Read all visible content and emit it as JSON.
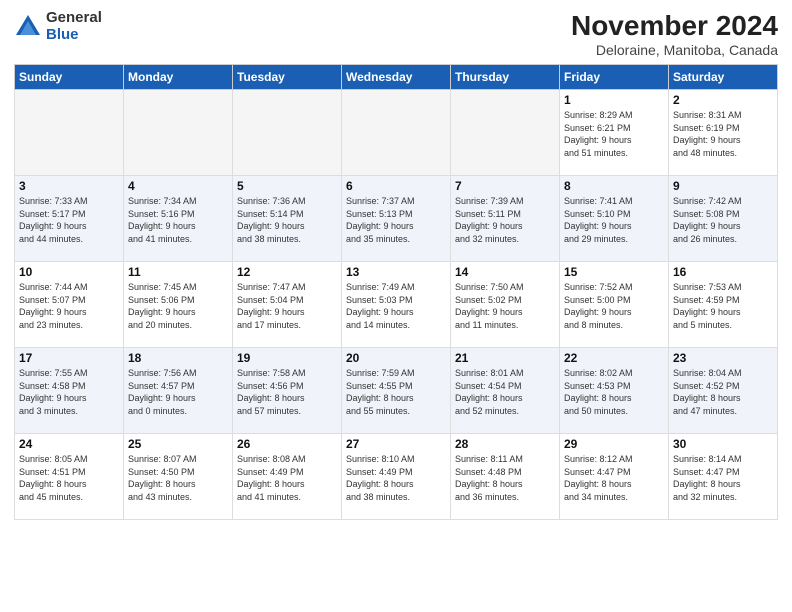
{
  "header": {
    "logo_general": "General",
    "logo_blue": "Blue",
    "month_year": "November 2024",
    "location": "Deloraine, Manitoba, Canada"
  },
  "days_of_week": [
    "Sunday",
    "Monday",
    "Tuesday",
    "Wednesday",
    "Thursday",
    "Friday",
    "Saturday"
  ],
  "weeks": [
    [
      {
        "day": "",
        "detail": "",
        "empty": true
      },
      {
        "day": "",
        "detail": "",
        "empty": true
      },
      {
        "day": "",
        "detail": "",
        "empty": true
      },
      {
        "day": "",
        "detail": "",
        "empty": true
      },
      {
        "day": "",
        "detail": "",
        "empty": true
      },
      {
        "day": "1",
        "detail": "Sunrise: 8:29 AM\nSunset: 6:21 PM\nDaylight: 9 hours\nand 51 minutes."
      },
      {
        "day": "2",
        "detail": "Sunrise: 8:31 AM\nSunset: 6:19 PM\nDaylight: 9 hours\nand 48 minutes."
      }
    ],
    [
      {
        "day": "3",
        "detail": "Sunrise: 7:33 AM\nSunset: 5:17 PM\nDaylight: 9 hours\nand 44 minutes."
      },
      {
        "day": "4",
        "detail": "Sunrise: 7:34 AM\nSunset: 5:16 PM\nDaylight: 9 hours\nand 41 minutes."
      },
      {
        "day": "5",
        "detail": "Sunrise: 7:36 AM\nSunset: 5:14 PM\nDaylight: 9 hours\nand 38 minutes."
      },
      {
        "day": "6",
        "detail": "Sunrise: 7:37 AM\nSunset: 5:13 PM\nDaylight: 9 hours\nand 35 minutes."
      },
      {
        "day": "7",
        "detail": "Sunrise: 7:39 AM\nSunset: 5:11 PM\nDaylight: 9 hours\nand 32 minutes."
      },
      {
        "day": "8",
        "detail": "Sunrise: 7:41 AM\nSunset: 5:10 PM\nDaylight: 9 hours\nand 29 minutes."
      },
      {
        "day": "9",
        "detail": "Sunrise: 7:42 AM\nSunset: 5:08 PM\nDaylight: 9 hours\nand 26 minutes."
      }
    ],
    [
      {
        "day": "10",
        "detail": "Sunrise: 7:44 AM\nSunset: 5:07 PM\nDaylight: 9 hours\nand 23 minutes."
      },
      {
        "day": "11",
        "detail": "Sunrise: 7:45 AM\nSunset: 5:06 PM\nDaylight: 9 hours\nand 20 minutes."
      },
      {
        "day": "12",
        "detail": "Sunrise: 7:47 AM\nSunset: 5:04 PM\nDaylight: 9 hours\nand 17 minutes."
      },
      {
        "day": "13",
        "detail": "Sunrise: 7:49 AM\nSunset: 5:03 PM\nDaylight: 9 hours\nand 14 minutes."
      },
      {
        "day": "14",
        "detail": "Sunrise: 7:50 AM\nSunset: 5:02 PM\nDaylight: 9 hours\nand 11 minutes."
      },
      {
        "day": "15",
        "detail": "Sunrise: 7:52 AM\nSunset: 5:00 PM\nDaylight: 9 hours\nand 8 minutes."
      },
      {
        "day": "16",
        "detail": "Sunrise: 7:53 AM\nSunset: 4:59 PM\nDaylight: 9 hours\nand 5 minutes."
      }
    ],
    [
      {
        "day": "17",
        "detail": "Sunrise: 7:55 AM\nSunset: 4:58 PM\nDaylight: 9 hours\nand 3 minutes."
      },
      {
        "day": "18",
        "detail": "Sunrise: 7:56 AM\nSunset: 4:57 PM\nDaylight: 9 hours\nand 0 minutes."
      },
      {
        "day": "19",
        "detail": "Sunrise: 7:58 AM\nSunset: 4:56 PM\nDaylight: 8 hours\nand 57 minutes."
      },
      {
        "day": "20",
        "detail": "Sunrise: 7:59 AM\nSunset: 4:55 PM\nDaylight: 8 hours\nand 55 minutes."
      },
      {
        "day": "21",
        "detail": "Sunrise: 8:01 AM\nSunset: 4:54 PM\nDaylight: 8 hours\nand 52 minutes."
      },
      {
        "day": "22",
        "detail": "Sunrise: 8:02 AM\nSunset: 4:53 PM\nDaylight: 8 hours\nand 50 minutes."
      },
      {
        "day": "23",
        "detail": "Sunrise: 8:04 AM\nSunset: 4:52 PM\nDaylight: 8 hours\nand 47 minutes."
      }
    ],
    [
      {
        "day": "24",
        "detail": "Sunrise: 8:05 AM\nSunset: 4:51 PM\nDaylight: 8 hours\nand 45 minutes."
      },
      {
        "day": "25",
        "detail": "Sunrise: 8:07 AM\nSunset: 4:50 PM\nDaylight: 8 hours\nand 43 minutes."
      },
      {
        "day": "26",
        "detail": "Sunrise: 8:08 AM\nSunset: 4:49 PM\nDaylight: 8 hours\nand 41 minutes."
      },
      {
        "day": "27",
        "detail": "Sunrise: 8:10 AM\nSunset: 4:49 PM\nDaylight: 8 hours\nand 38 minutes."
      },
      {
        "day": "28",
        "detail": "Sunrise: 8:11 AM\nSunset: 4:48 PM\nDaylight: 8 hours\nand 36 minutes."
      },
      {
        "day": "29",
        "detail": "Sunrise: 8:12 AM\nSunset: 4:47 PM\nDaylight: 8 hours\nand 34 minutes."
      },
      {
        "day": "30",
        "detail": "Sunrise: 8:14 AM\nSunset: 4:47 PM\nDaylight: 8 hours\nand 32 minutes."
      }
    ]
  ]
}
